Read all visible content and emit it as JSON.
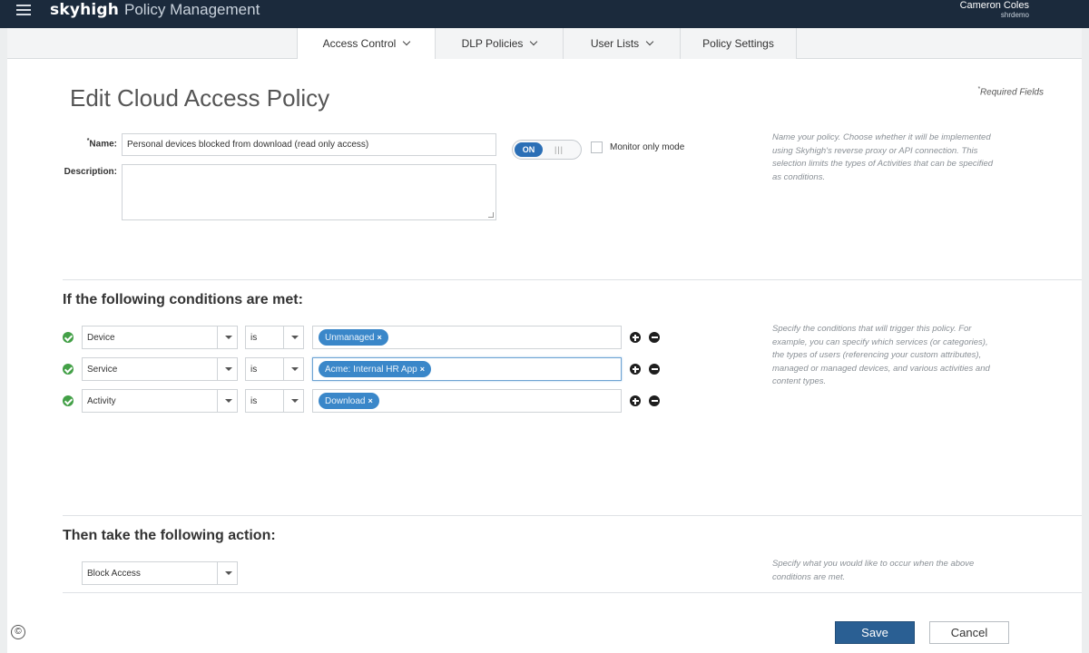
{
  "header": {
    "logo": "skyhigh",
    "app_title": "Policy Management",
    "user_name": "Cameron Coles",
    "user_org": "shrdemo"
  },
  "nav": {
    "tabs": [
      {
        "label": "Access Control",
        "active": true,
        "has_dropdown": true
      },
      {
        "label": "DLP Policies",
        "active": false,
        "has_dropdown": true
      },
      {
        "label": "User Lists",
        "active": false,
        "has_dropdown": true
      },
      {
        "label": "Policy Settings",
        "active": false,
        "has_dropdown": false
      }
    ]
  },
  "page": {
    "title": "Edit Cloud Access Policy",
    "required_note": "Required Fields",
    "required_marker": "*"
  },
  "form": {
    "name_label": "Name:",
    "name_value": "Personal devices blocked from download (read only access)",
    "description_label": "Description:",
    "description_value": "",
    "toggle_label": "ON",
    "toggle_state": "on",
    "monitor_label": "Monitor only mode",
    "monitor_checked": false,
    "help": "Name your policy. Choose whether it will be implemented using Skyhigh's reverse proxy or API connection. This selection limits the types of Activities that can be specified as conditions."
  },
  "conditions": {
    "title": "If the following conditions are met:",
    "help": "Specify the conditions that will trigger this policy. For example, you can specify which services (or categories), the types of users (referencing your custom attributes), managed or managed devices, and various activities and content types.",
    "rows": [
      {
        "field": "Device",
        "operator": "is",
        "value": "Unmanaged"
      },
      {
        "field": "Service",
        "operator": "is",
        "value": "Acme: Internal HR App"
      },
      {
        "field": "Activity",
        "operator": "is",
        "value": "Download"
      }
    ]
  },
  "action": {
    "title": "Then take the following action:",
    "value": "Block Access",
    "help": "Specify what you would like to occur when the above conditions are met."
  },
  "buttons": {
    "save": "Save",
    "cancel": "Cancel"
  },
  "footer": {
    "copyright_symbol": "©"
  },
  "colors": {
    "header_bg": "#1b2a3c",
    "accent": "#2b6fb6",
    "tag": "#3a87c9",
    "check": "#43a047",
    "save_button": "#2a5f93"
  }
}
